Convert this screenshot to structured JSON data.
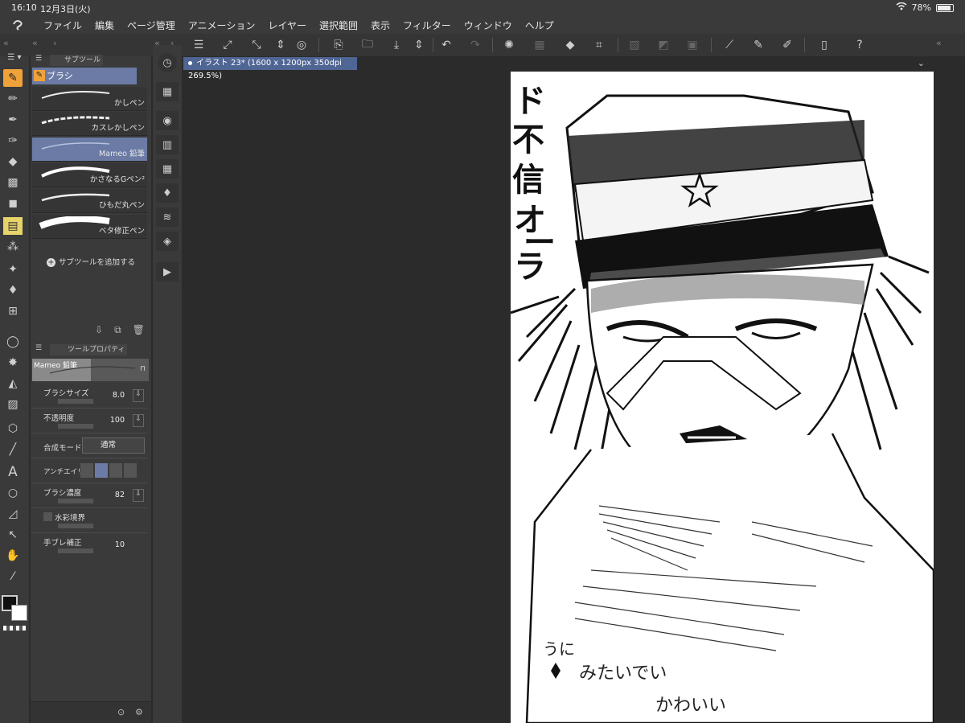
{
  "status": {
    "time": "16:10",
    "date": "12月3日(火)",
    "battery": "78%",
    "battery_level": 0.78
  },
  "menu": [
    "ファイル",
    "編集",
    "ページ管理",
    "アニメーション",
    "レイヤー",
    "選択範囲",
    "表示",
    "フィルター",
    "ウィンドウ",
    "ヘルプ"
  ],
  "subtool": {
    "panel_title": "サブツール",
    "group": "ブラシ",
    "brushes": [
      {
        "label": "かしペン"
      },
      {
        "label": "カスレかしペン"
      },
      {
        "label": "Mameo 鉛筆"
      },
      {
        "label": "かさなるGペン²"
      },
      {
        "label": "ひもだ丸ペン"
      },
      {
        "label": "ベタ修正ペン"
      }
    ],
    "add_label": "サブツールを追加する"
  },
  "toolprop": {
    "title": "ツールプロパティ",
    "preview_label": "Mameo 鉛筆",
    "brush_size_label": "ブラシサイズ",
    "brush_size": "8.0",
    "opacity_label": "不透明度",
    "opacity": "100",
    "blend_label": "合成モード",
    "blend_value": "通常",
    "aa_label": "アンチエイリ",
    "density_label": "ブラシ濃度",
    "density": "82",
    "watercolor_label": "水彩境界",
    "stabilizer_label": "手ブレ補正",
    "stabilizer": "10"
  },
  "document": {
    "tab": "イラスト 23* (1600 x 1200px 350dpi 269.5%)"
  },
  "artwork": {
    "vertical_text": [
      "ド",
      "不",
      "信",
      "オ",
      "ー",
      "ラ"
    ],
    "note_line1": "うに",
    "note_line2": "みたいでい",
    "note_line3": "かわいい"
  },
  "colors": {
    "accent": "#f0a23a",
    "selection": "#6b7ba6",
    "tab": "#4f6594"
  }
}
